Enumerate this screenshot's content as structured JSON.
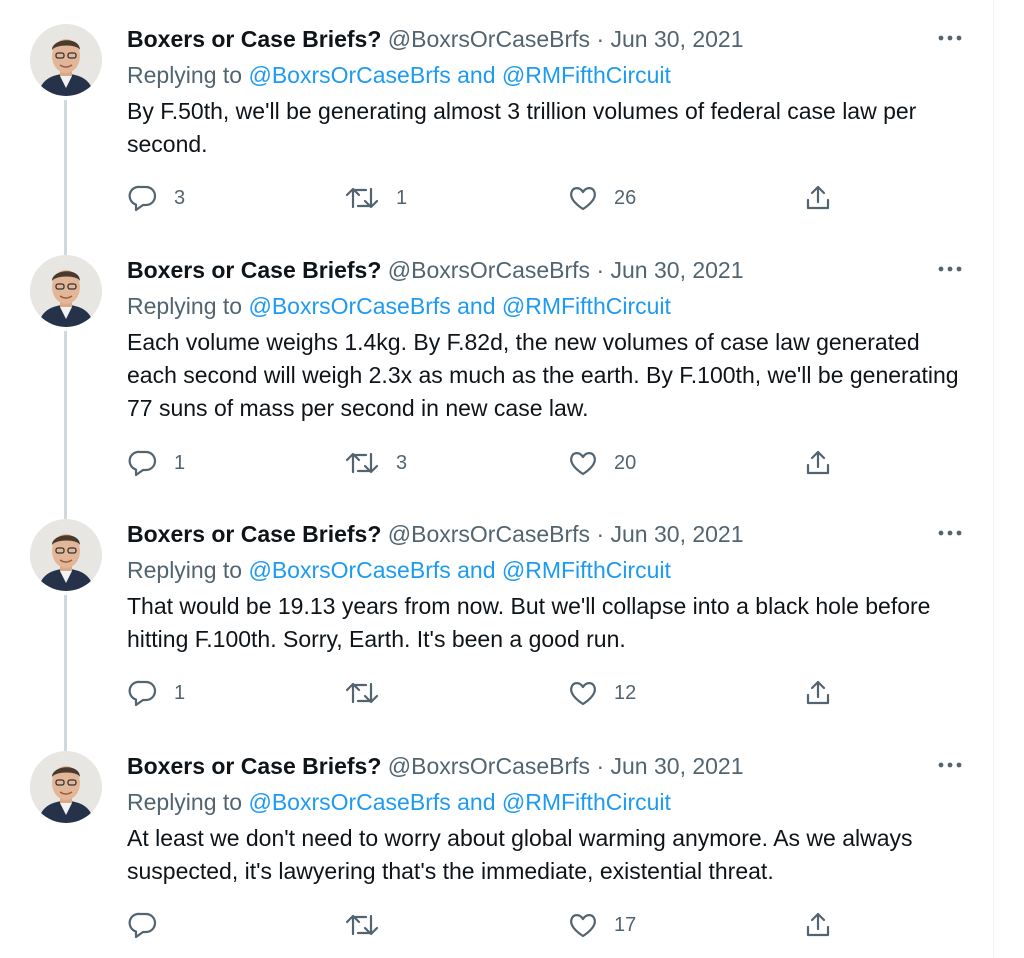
{
  "colors": {
    "text": "#0f1419",
    "secondary": "#536471",
    "link": "#1d9bf0",
    "thread_line": "#cfd9de"
  },
  "icons": {
    "reply": "reply-icon",
    "retweet": "retweet-icon",
    "like": "like-icon",
    "share": "share-icon",
    "more": "more-icon"
  },
  "tweets": [
    {
      "name": "Boxers or Case Briefs?",
      "handle": "@BoxrsOrCaseBrfs",
      "separator": "·",
      "date": "Jun 30, 2021",
      "replying_prefix": "Replying to",
      "replying_to": "@BoxrsOrCaseBrfs and @RMFifthCircuit",
      "text": "By F.50th, we'll be generating almost 3 trillion volumes of federal case law per second.",
      "replies": "3",
      "retweets": "1",
      "likes": "26"
    },
    {
      "name": "Boxers or Case Briefs?",
      "handle": "@BoxrsOrCaseBrfs",
      "separator": "·",
      "date": "Jun 30, 2021",
      "replying_prefix": "Replying to",
      "replying_to": "@BoxrsOrCaseBrfs and @RMFifthCircuit",
      "text": "Each volume weighs 1.4kg. By F.82d, the new volumes of case law generated each second will weigh 2.3x as much as the earth. By F.100th, we'll be generating 77 suns of mass per second in new case law.",
      "replies": "1",
      "retweets": "3",
      "likes": "20"
    },
    {
      "name": "Boxers or Case Briefs?",
      "handle": "@BoxrsOrCaseBrfs",
      "separator": "·",
      "date": "Jun 30, 2021",
      "replying_prefix": "Replying to",
      "replying_to": "@BoxrsOrCaseBrfs and @RMFifthCircuit",
      "text": "That would be 19.13 years from now. But we'll collapse into a black hole before hitting F.100th. Sorry, Earth. It's been a good run.",
      "replies": "1",
      "retweets": "",
      "likes": "12"
    },
    {
      "name": "Boxers or Case Briefs?",
      "handle": "@BoxrsOrCaseBrfs",
      "separator": "·",
      "date": "Jun 30, 2021",
      "replying_prefix": "Replying to",
      "replying_to": "@BoxrsOrCaseBrfs and @RMFifthCircuit",
      "text": "At least we don't need to worry about global warming anymore. As we always suspected, it's lawyering that's the immediate, existential threat.",
      "replies": "",
      "retweets": "",
      "likes": "17"
    }
  ]
}
